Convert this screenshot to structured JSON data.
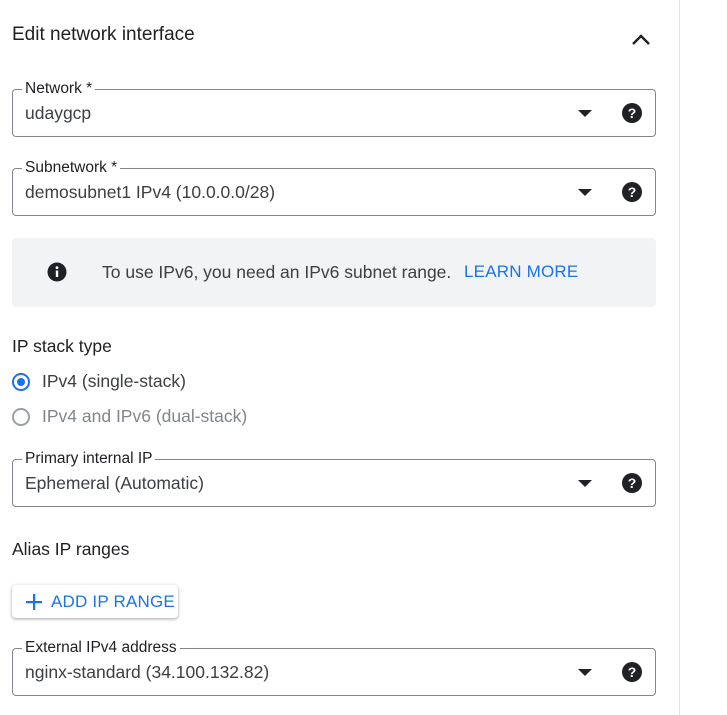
{
  "section": {
    "title": "Edit network interface"
  },
  "network": {
    "label": "Network *",
    "value": "udaygcp"
  },
  "subnetwork": {
    "label": "Subnetwork *",
    "value": "demosubnet1 IPv4 (10.0.0.0/28)"
  },
  "info_banner": {
    "message": "To use IPv6, you need an IPv6 subnet range.",
    "link": "LEARN MORE"
  },
  "ip_stack": {
    "heading": "IP stack type",
    "options": [
      {
        "label": "IPv4 (single-stack)",
        "selected": true
      },
      {
        "label": "IPv4 and IPv6 (dual-stack)",
        "selected": false
      }
    ]
  },
  "primary_ip": {
    "label": "Primary internal IP",
    "value": "Ephemeral (Automatic)"
  },
  "alias": {
    "heading": "Alias IP ranges",
    "add_button": "ADD IP RANGE"
  },
  "external_ip": {
    "label": "External IPv4 address",
    "value": "nginx-standard (34.100.132.82)"
  },
  "colors": {
    "accent": "#1a73e8",
    "text": "#202124",
    "info_bg": "#f1f3f4",
    "border": "#80868b"
  },
  "icons": {
    "collapse": "chevron-up-icon",
    "help": "help-circle-icon",
    "info": "info-icon",
    "add": "plus-icon"
  }
}
